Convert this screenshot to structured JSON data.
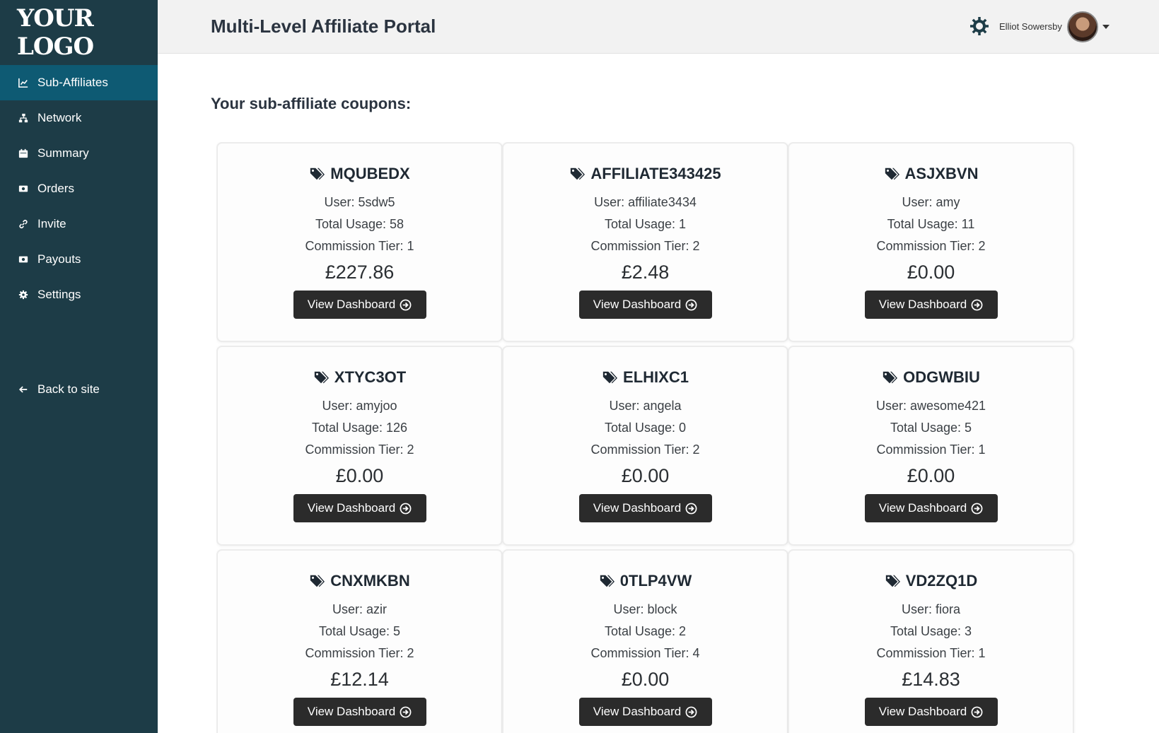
{
  "sidebar": {
    "logo": "YOUR LOGO",
    "items": [
      {
        "label": "Sub-Affiliates",
        "icon": "chart-line-icon",
        "active": true
      },
      {
        "label": "Network",
        "icon": "sitemap-icon"
      },
      {
        "label": "Summary",
        "icon": "calendar-icon"
      },
      {
        "label": "Orders",
        "icon": "money-icon"
      },
      {
        "label": "Invite",
        "icon": "link-icon"
      },
      {
        "label": "Payouts",
        "icon": "money-icon"
      },
      {
        "label": "Settings",
        "icon": "gear-icon"
      }
    ],
    "back": {
      "label": "Back to site",
      "icon": "arrow-left-icon"
    }
  },
  "header": {
    "title": "Multi-Level Affiliate Portal",
    "user_name": "Elliot Sowersby"
  },
  "main": {
    "section_title": "Your sub-affiliate coupons:",
    "button_label": "View Dashboard",
    "coupons": [
      {
        "code": "MQUBEDX",
        "user": "User: 5sdw5",
        "usage": "Total Usage: 58",
        "tier": "Commission Tier: 1",
        "amount": "£227.86"
      },
      {
        "code": "AFFILIATE343425",
        "user": "User: affiliate3434",
        "usage": "Total Usage: 1",
        "tier": "Commission Tier: 2",
        "amount": "£2.48"
      },
      {
        "code": "ASJXBVN",
        "user": "User: amy",
        "usage": "Total Usage: 11",
        "tier": "Commission Tier: 2",
        "amount": "£0.00"
      },
      {
        "code": "XTYC3OT",
        "user": "User: amyjoo",
        "usage": "Total Usage: 126",
        "tier": "Commission Tier: 2",
        "amount": "£0.00"
      },
      {
        "code": "ELHIXC1",
        "user": "User: angela",
        "usage": "Total Usage: 0",
        "tier": "Commission Tier: 2",
        "amount": "£0.00"
      },
      {
        "code": "ODGWBIU",
        "user": "User: awesome421",
        "usage": "Total Usage: 5",
        "tier": "Commission Tier: 1",
        "amount": "£0.00"
      },
      {
        "code": "CNXMKBN",
        "user": "User: azir",
        "usage": "Total Usage: 5",
        "tier": "Commission Tier: 2",
        "amount": "£12.14"
      },
      {
        "code": "0TLP4VW",
        "user": "User: block",
        "usage": "Total Usage: 2",
        "tier": "Commission Tier: 4",
        "amount": "£0.00"
      },
      {
        "code": "VD2ZQ1D",
        "user": "User: fiora",
        "usage": "Total Usage: 3",
        "tier": "Commission Tier: 1",
        "amount": "£14.83"
      }
    ]
  },
  "colors": {
    "sidebar": "#1d3c47",
    "active": "#0e5a73",
    "button": "#2b2b2b"
  }
}
